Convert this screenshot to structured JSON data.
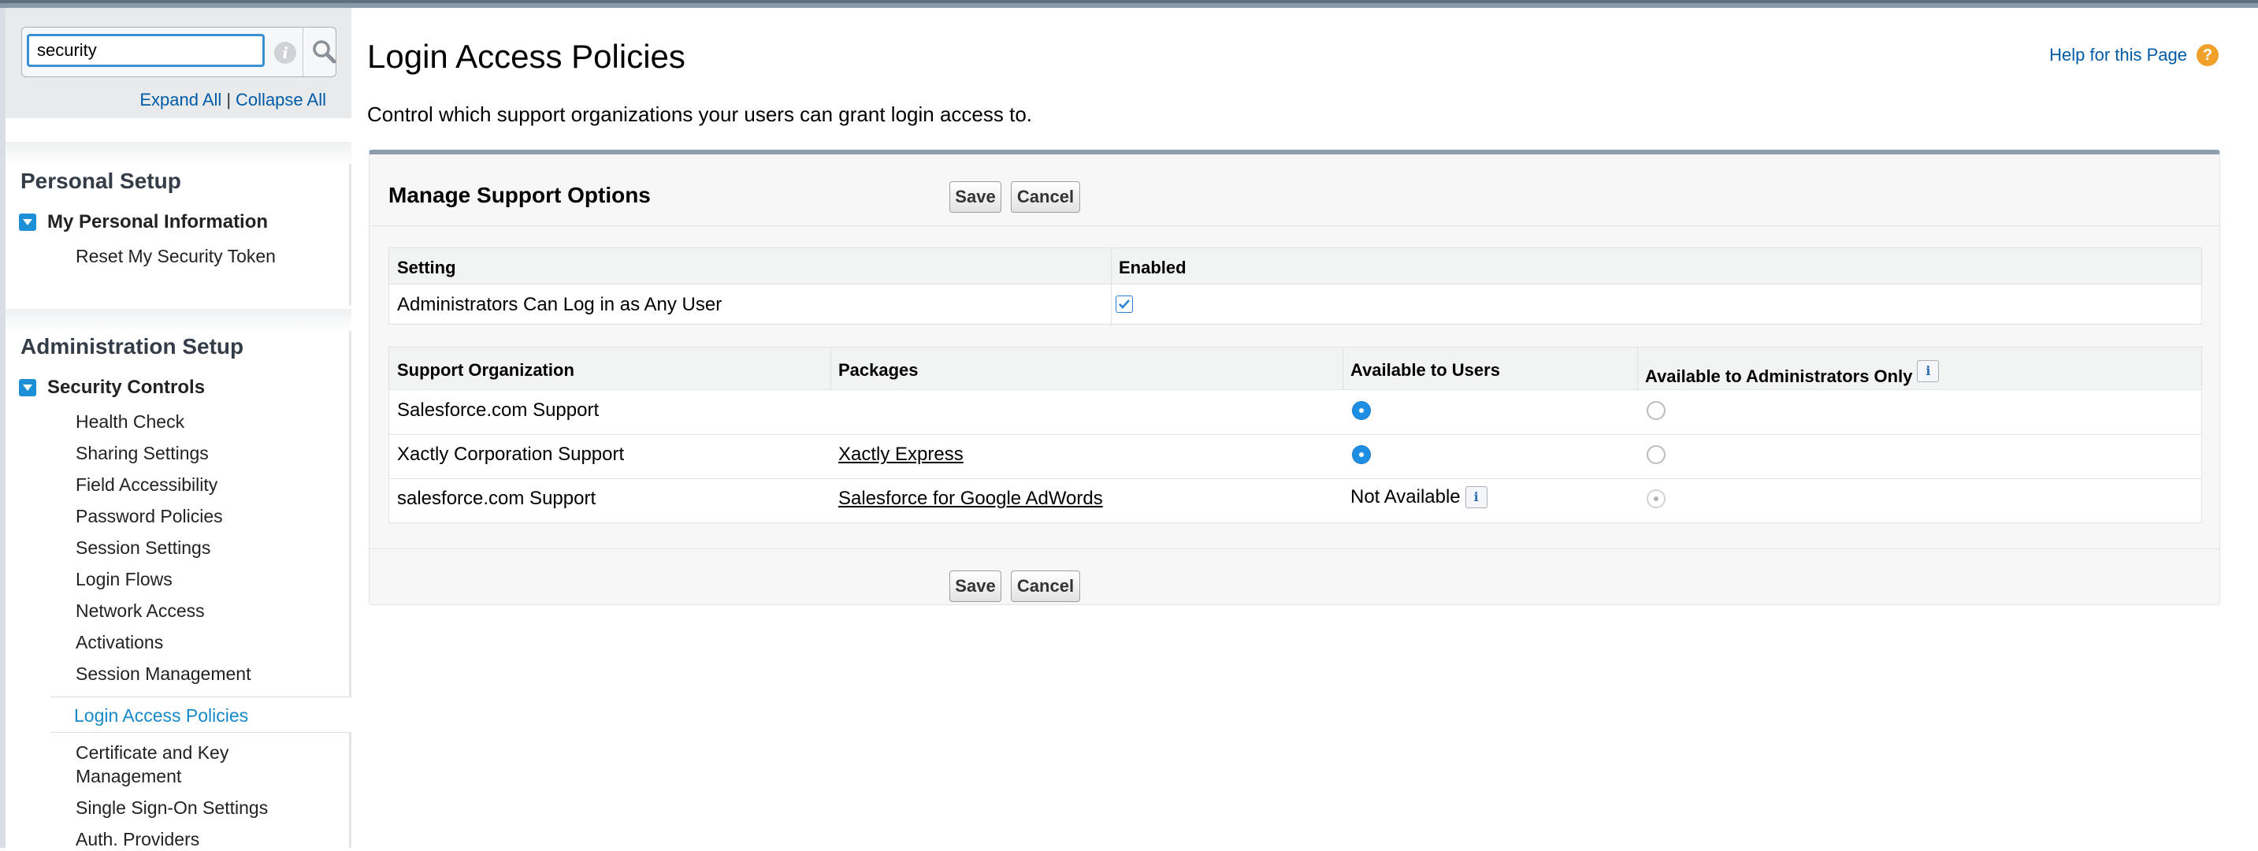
{
  "sidebar": {
    "search": {
      "value": "security"
    },
    "expand_all": "Expand All",
    "separator": "|",
    "collapse_all": "Collapse All",
    "sections": [
      {
        "title": "Personal Setup",
        "groups": [
          {
            "label": "My Personal Information",
            "items": [
              "Reset My Security Token"
            ]
          }
        ]
      },
      {
        "title": "Administration Setup",
        "groups": [
          {
            "label": "Security Controls",
            "items": [
              "Health Check",
              "Sharing Settings",
              "Field Accessibility",
              "Password Policies",
              "Session Settings",
              "Login Flows",
              "Network Access",
              "Activations",
              "Session Management",
              "Login Access Policies",
              "Certificate and Key",
              "Management",
              "Single Sign-On Settings",
              "Auth. Providers"
            ]
          }
        ]
      }
    ]
  },
  "header": {
    "title": "Login Access Policies",
    "help_link": "Help for this Page",
    "description": "Control which support organizations your users can grant login access to."
  },
  "panel": {
    "title": "Manage Support Options",
    "save_label": "Save",
    "cancel_label": "Cancel",
    "settings_table": {
      "columns": [
        "Setting",
        "Enabled"
      ],
      "rows": [
        {
          "setting": "Administrators Can Log in as Any User",
          "enabled": true
        }
      ]
    },
    "support_table": {
      "columns": [
        "Support Organization",
        "Packages",
        "Available to Users",
        "Available to Administrators Only"
      ],
      "rows": [
        {
          "org": "Salesforce.com Support",
          "package": "",
          "available_to_users": "selected",
          "admins_only": "unselected"
        },
        {
          "org": "Xactly Corporation Support",
          "package": "Xactly Express",
          "available_to_users": "selected",
          "admins_only": "unselected"
        },
        {
          "org": "salesforce.com Support",
          "package": "Salesforce for Google AdWords",
          "available_to_users_text": "Not Available",
          "admins_only": "selected-disabled"
        }
      ]
    }
  },
  "colors": {
    "accent": "#1589c9",
    "link": "#015ba7",
    "radio_selected": "#1e8ee5",
    "panel_top_border": "#8e9dab",
    "help_icon": "#f0a12a"
  },
  "icons": [
    "info-icon",
    "search-icon",
    "expand-toggle-icon",
    "help-icon",
    "checkmark-icon",
    "info-square-icon"
  ]
}
